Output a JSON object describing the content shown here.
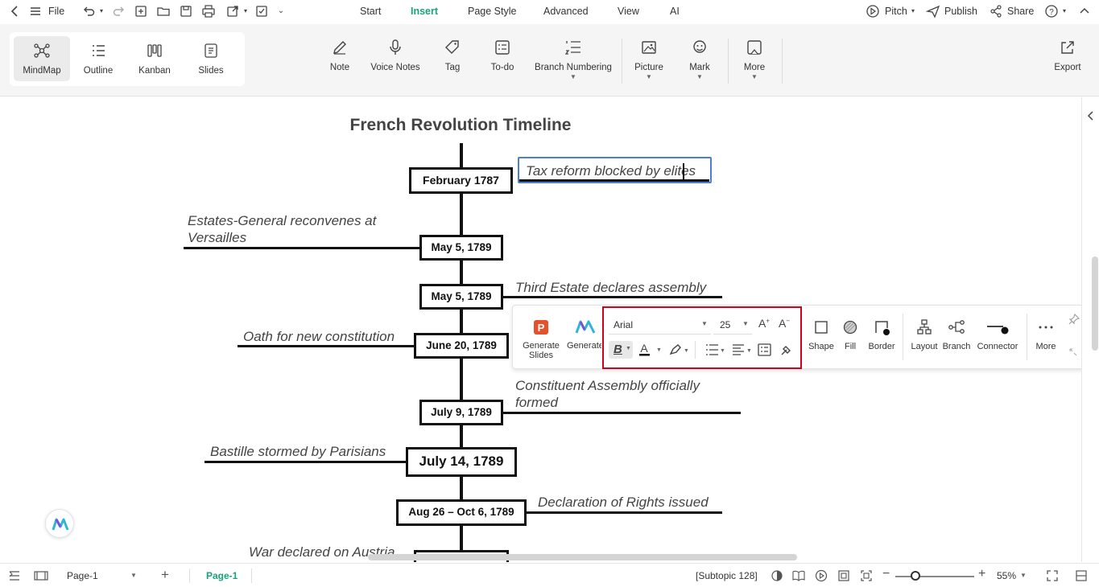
{
  "topbar": {
    "file_label": "File",
    "tabs": [
      "Start",
      "Insert",
      "Page Style",
      "Advanced",
      "View",
      "AI"
    ],
    "active_tab": "Insert",
    "pitch_label": "Pitch",
    "publish_label": "Publish",
    "share_label": "Share"
  },
  "views": {
    "mindmap": "MindMap",
    "outline": "Outline",
    "kanban": "Kanban",
    "slides": "Slides"
  },
  "ribbon": {
    "note": "Note",
    "voice_notes": "Voice Notes",
    "tag": "Tag",
    "todo": "To-do",
    "branch_numbering": "Branch Numbering",
    "picture": "Picture",
    "mark": "Mark",
    "more": "More",
    "export": "Export"
  },
  "map": {
    "title": "French Revolution Timeline",
    "dates": [
      "February 1787",
      "May 5, 1789",
      "May 5, 1789",
      "June 20, 1789",
      "July 9, 1789",
      "July 14, 1789",
      "Aug 26 – Oct 6, 1789"
    ],
    "events": {
      "tax": "Tax reform blocked by elites",
      "estates_1": "Estates-General reconvenes at",
      "estates_2": "Versailles",
      "third": "Third Estate declares assembly",
      "oath": "Oath for new constitution",
      "constituent_1": "Constituent Assembly officially",
      "constituent_2": "formed",
      "bastille": "Bastille stormed by Parisians",
      "rights": "Declaration of Rights issued",
      "war": "War declared on Austria"
    }
  },
  "floatbar": {
    "generate_slides_1": "Generate",
    "generate_slides_2": "Slides",
    "generate_label": "Generate",
    "font_name": "Arial",
    "font_size": "25",
    "shape": "Shape",
    "fill": "Fill",
    "border": "Border",
    "layout": "Layout",
    "branch": "Branch",
    "connector": "Connector",
    "more": "More",
    "highlight_color": "#d0021b"
  },
  "status": {
    "page_select": "Page-1",
    "page_tab": "Page-1",
    "selection": "[Subtopic 128]",
    "zoom": "55%",
    "zoom_level": 0.26
  },
  "colors": {
    "accent": "#1aa37a",
    "selection_border": "#4a7fd4"
  }
}
